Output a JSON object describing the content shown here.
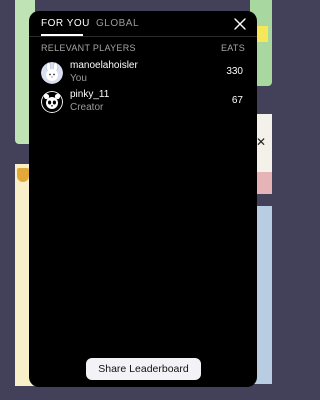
{
  "tabs": [
    {
      "label": "FOR YOU",
      "active": true
    },
    {
      "label": "GLOBAL",
      "active": false
    }
  ],
  "close_icon": "close-icon",
  "section": {
    "title": "RELEVANT PLAYERS",
    "metric_label": "EATS"
  },
  "players": [
    {
      "name": "manoelahoisler",
      "subtitle": "You",
      "score": "330",
      "avatar_icon": "bunny-avatar-icon"
    },
    {
      "name": "pinky_11",
      "subtitle": "Creator",
      "score": "67",
      "avatar_icon": "panda-avatar-icon"
    }
  ],
  "share_button": "Share Leaderboard",
  "colors": {
    "modal_bg": "#000000",
    "page_bg": "#43405a",
    "muted_text": "#9a9a9a",
    "button_bg": "#f3f3f7"
  }
}
